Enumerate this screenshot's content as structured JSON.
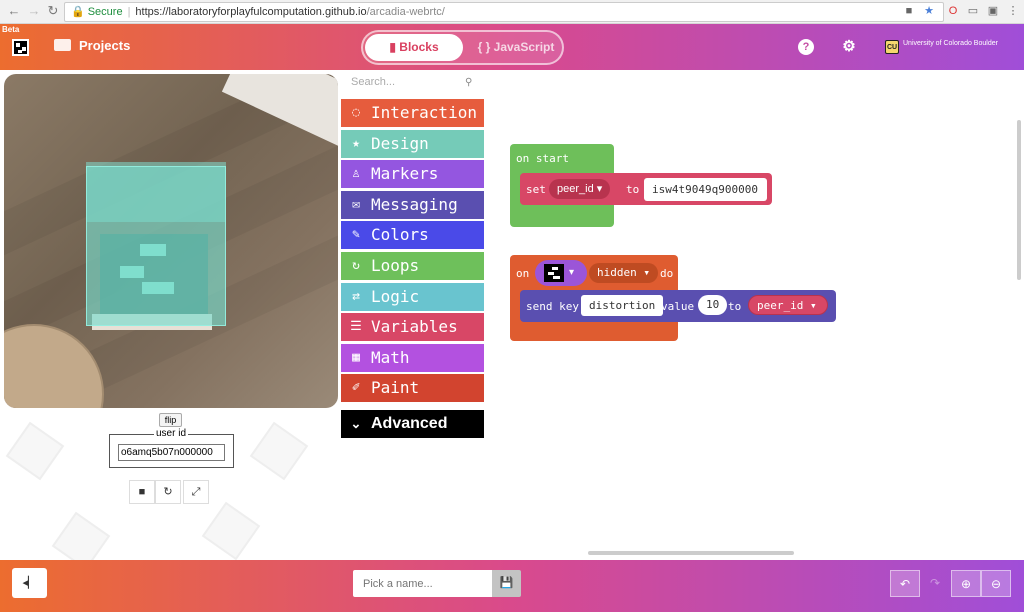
{
  "browser": {
    "secure_label": "Secure",
    "url_base": "https://laboratoryforplayfulcomputation.github.io",
    "url_path": "/arcadia-webrtc/"
  },
  "header": {
    "beta_label": "Beta",
    "projects_label": "Projects",
    "tabs": {
      "blocks": "Blocks",
      "javascript": "{ } JavaScript"
    },
    "university": "University of Colorado Boulder",
    "colors": {
      "gradient_start": "#ec6d2f",
      "gradient_mid": "#d94a8c",
      "gradient_end": "#a04ed8"
    }
  },
  "simulator": {
    "flip_label": "flip",
    "user_id_legend": "user id",
    "user_id_value": "o6amq5b07n000000"
  },
  "toolbox": {
    "search_placeholder": "Search...",
    "categories": [
      {
        "label": "Interaction",
        "color": "#e65c3d",
        "icon": "spinner-icon"
      },
      {
        "label": "Design",
        "color": "#75cbb8",
        "icon": "star-icon"
      },
      {
        "label": "Markers",
        "color": "#9456e0",
        "icon": "joystick-icon"
      },
      {
        "label": "Messaging",
        "color": "#5a4fb0",
        "icon": "envelope-icon"
      },
      {
        "label": "Colors",
        "color": "#4a4ae8",
        "icon": "brush-icon"
      },
      {
        "label": "Loops",
        "color": "#6ec05b",
        "icon": "refresh-icon"
      },
      {
        "label": "Logic",
        "color": "#69c4cf",
        "icon": "shuffle-icon"
      },
      {
        "label": "Variables",
        "color": "#d84766",
        "icon": "list-icon"
      },
      {
        "label": "Math",
        "color": "#b351e0",
        "icon": "calculator-icon"
      },
      {
        "label": "Paint",
        "color": "#d2442f",
        "icon": "paintbrush-icon"
      }
    ],
    "advanced": {
      "label": "Advanced",
      "color": "#000000"
    }
  },
  "workspace": {
    "on_start": {
      "label": "on start",
      "set": "set",
      "var": "peer_id",
      "to": "to",
      "value": "isw4t9049q900000",
      "color": "#6ebf5a"
    },
    "on_event": {
      "on": "on",
      "event": "hidden",
      "do": "do",
      "send_key": "send key",
      "key": "distortion",
      "value_label": "value",
      "value": "10",
      "to": "to",
      "var": "peer_id",
      "color": "#df5c30"
    }
  },
  "footer": {
    "name_placeholder": "Pick a name..."
  }
}
